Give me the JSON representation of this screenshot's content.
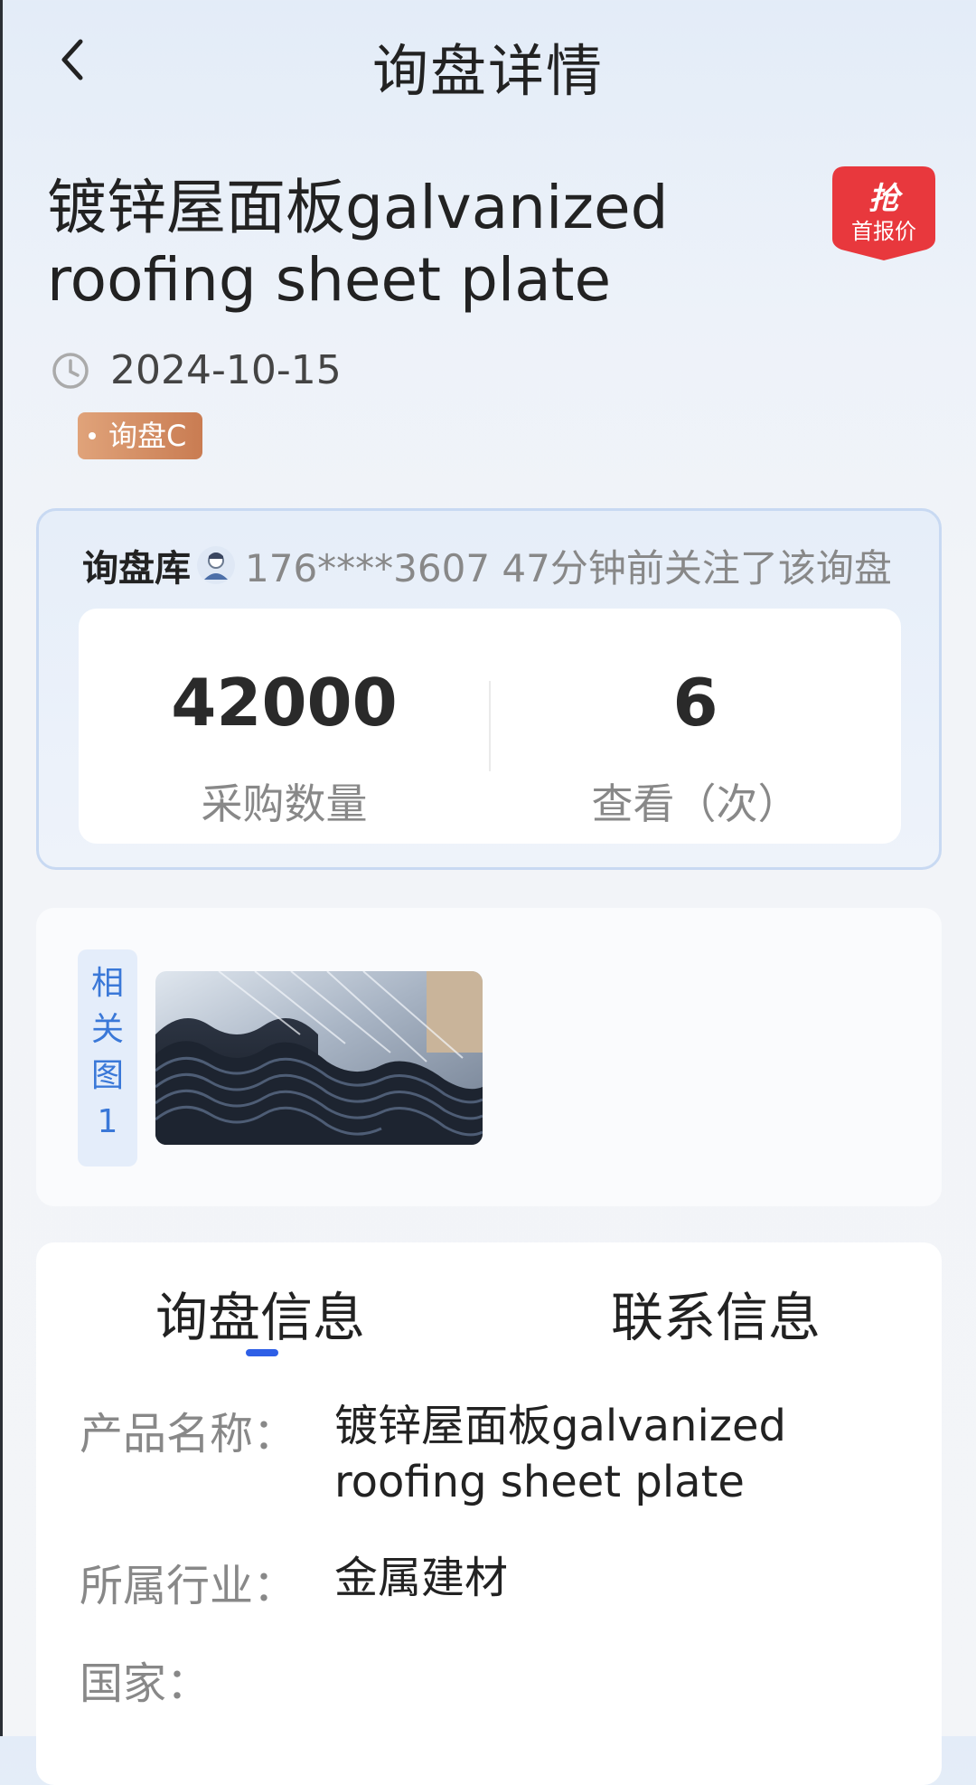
{
  "header": {
    "title": "询盘详情"
  },
  "product": {
    "title": "镀锌屋面板galvanized roofing sheet plate",
    "date": "2024-10-15",
    "tag": "询盘C"
  },
  "grab_badge": {
    "line1": "抢",
    "line2": "首报价",
    "color": "#e8383d"
  },
  "ticker": {
    "label": "询盘库",
    "text": "176****3607 47分钟前关注了该询盘"
  },
  "stats": {
    "quantity_value": "42000",
    "quantity_label": "采购数量",
    "views_value": "6",
    "views_label": "查看（次）"
  },
  "gallery": {
    "related_label": [
      "相",
      "关",
      "图",
      "1"
    ]
  },
  "tabs": {
    "inquiry": "询盘信息",
    "contact": "联系信息",
    "active": "inquiry",
    "accent": "#2e5fe6"
  },
  "info": {
    "rows": [
      {
        "key": "产品名称：",
        "value": "镀锌屋面板galvanized roofing sheet plate"
      },
      {
        "key": "所属行业：",
        "value": "金属建材"
      },
      {
        "key": "国家：",
        "value": ""
      }
    ]
  }
}
